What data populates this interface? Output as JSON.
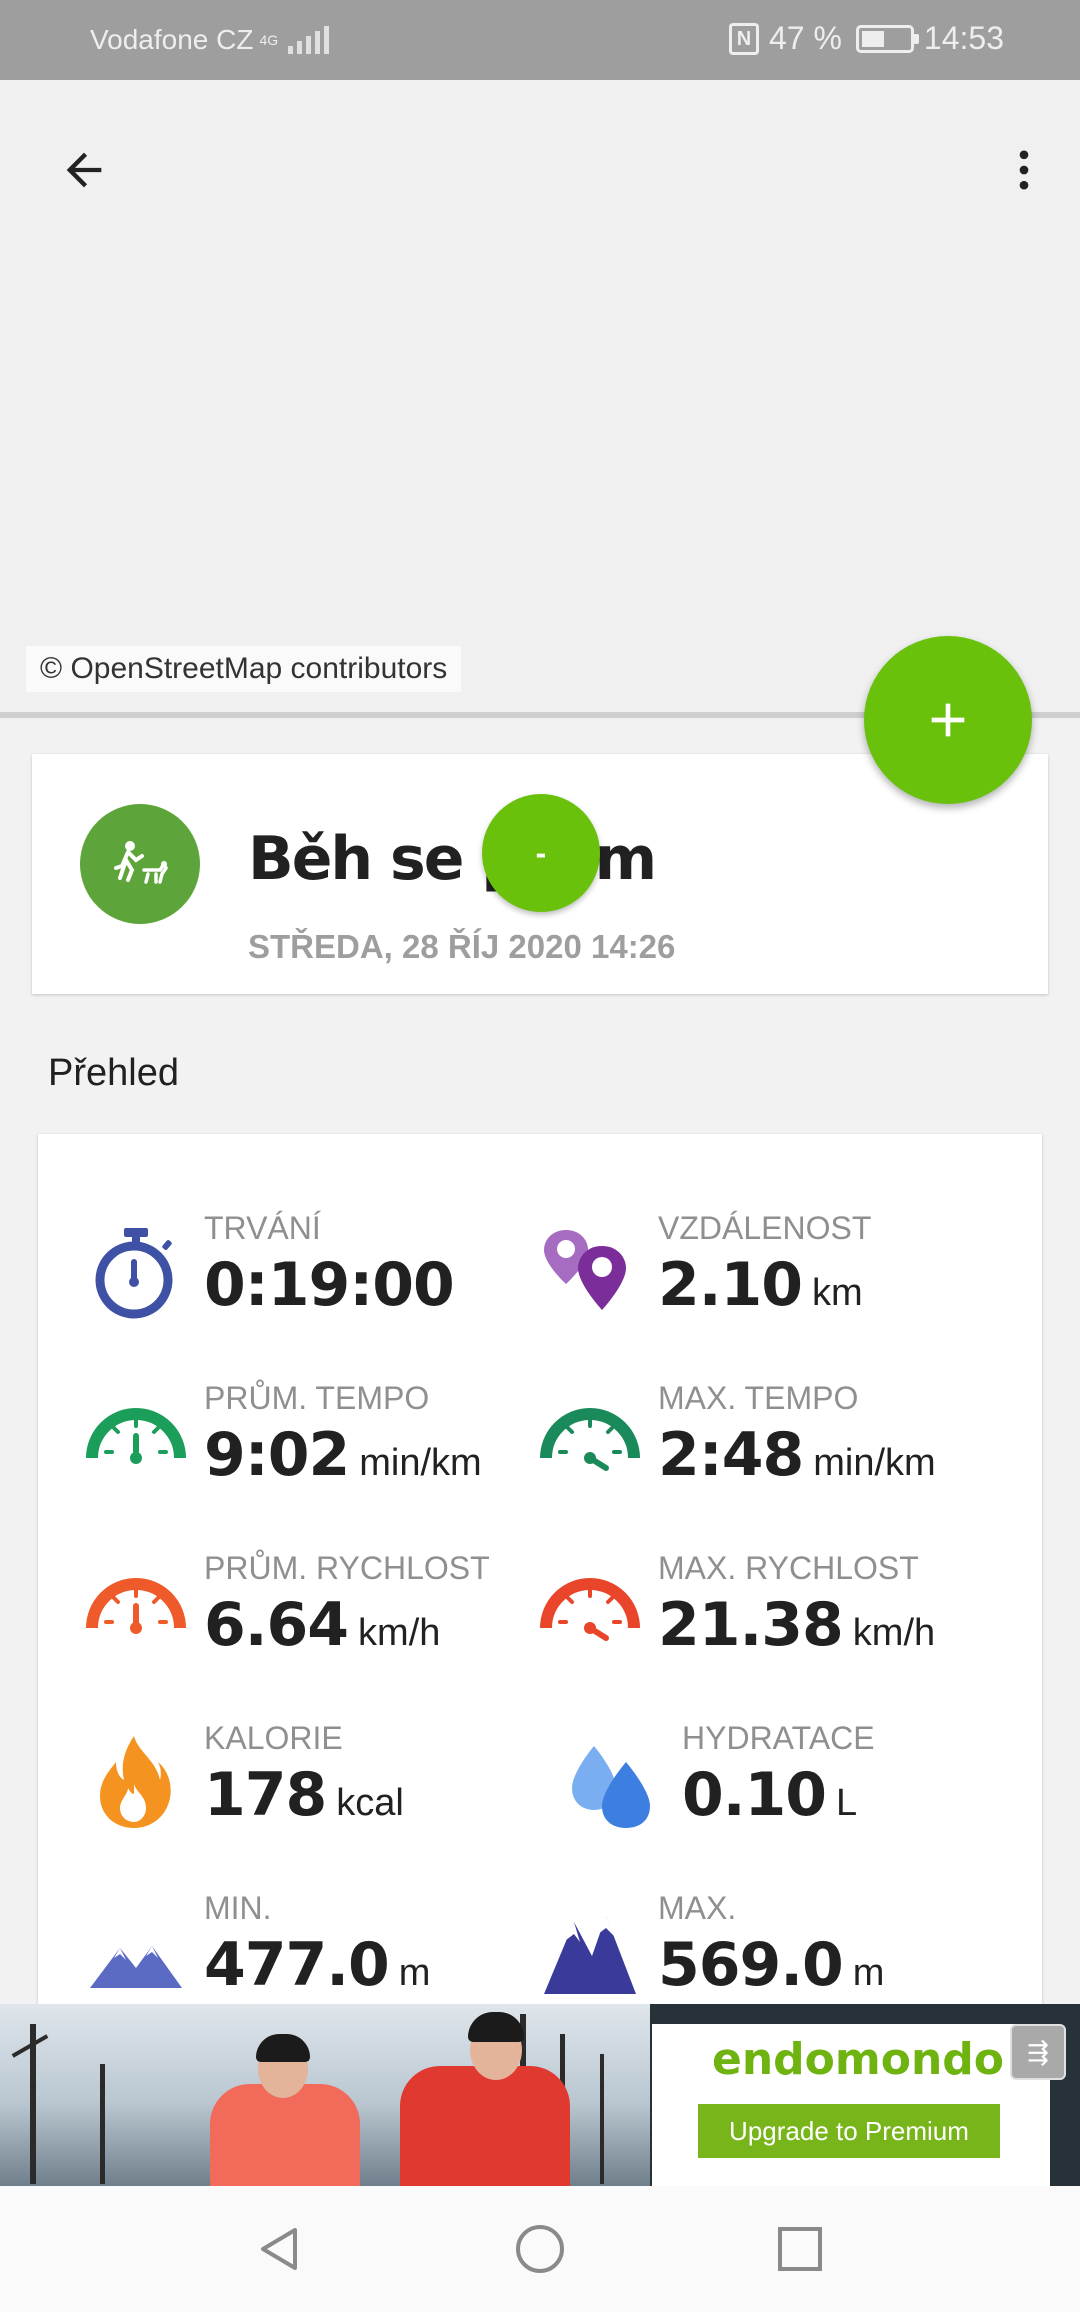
{
  "status_bar": {
    "carrier": "Vodafone CZ",
    "network": "4G",
    "battery": "47 %",
    "time": "14:53",
    "nfc_icon": "nfc-icon",
    "battery_icon": "battery-icon"
  },
  "map": {
    "attribution": "© OpenStreetMap contributors",
    "back_icon": "arrow-back-icon",
    "more_icon": "more-vert-icon",
    "fab_icon": "plus-icon"
  },
  "workout": {
    "title": "Běh se psem",
    "date": "STŘEDA, 28 ŘÍJ 2020 14:26",
    "sport_icon": "running-with-dog-icon",
    "overlay_label": "-"
  },
  "overview": {
    "title": "Přehled",
    "stats": [
      {
        "label": "TRVÁNÍ",
        "value": "0:19:00",
        "unit": "",
        "icon": "stopwatch-icon",
        "color": "#3f51a5"
      },
      {
        "label": "VZDÁLENOST",
        "value": "2.10",
        "unit": "km",
        "icon": "map-pins-icon",
        "color": "#8e44ad"
      },
      {
        "label": "PRŮM. TEMPO",
        "value": "9:02",
        "unit": "min/km",
        "icon": "speedometer-icon",
        "color": "#1b9e5a"
      },
      {
        "label": "MAX. TEMPO",
        "value": "2:48",
        "unit": "min/km",
        "icon": "speedometer-max-icon",
        "color": "#1b8a5a"
      },
      {
        "label": "PRŮM. RYCHLOST",
        "value": "6.64",
        "unit": "km/h",
        "icon": "speedometer-icon",
        "color": "#ee5a2a"
      },
      {
        "label": "MAX. RYCHLOST",
        "value": "21.38",
        "unit": "km/h",
        "icon": "speedometer-max-icon",
        "color": "#e8452a"
      },
      {
        "label": "KALORIE",
        "value": "178",
        "unit": "kcal",
        "icon": "flame-icon",
        "color": "#f59320"
      },
      {
        "label": "HYDRATACE",
        "value": "0.10",
        "unit": "L",
        "icon": "water-drops-icon",
        "color": "#4a90e2"
      },
      {
        "label": "MIN.",
        "value": "477.0",
        "unit": "m",
        "icon": "mountains-low-icon",
        "color": "#5b6bc4"
      },
      {
        "label": "MAX.",
        "value": "569.0",
        "unit": "m",
        "icon": "mountains-high-icon",
        "color": "#3a3a9a"
      }
    ]
  },
  "ad": {
    "brand": "endomondo",
    "cta": "Upgrade to Premium",
    "adchoice_icon": "ad-choices-icon"
  },
  "nav": {
    "back_icon": "nav-back-icon",
    "home_icon": "nav-home-icon",
    "recents_icon": "nav-recents-icon"
  }
}
